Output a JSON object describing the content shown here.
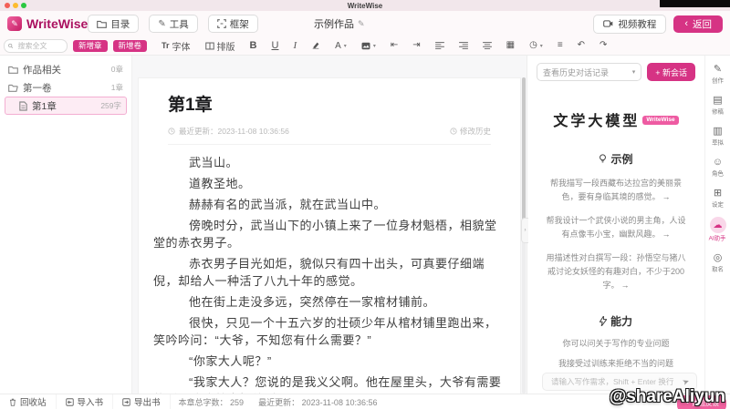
{
  "colors": {
    "accent": "#d63384",
    "brand_text": "#ab1160",
    "badge": "#ee5ba2"
  },
  "titlebar": {
    "window_title": "WriteWise"
  },
  "header": {
    "app_name": "WriteWise",
    "menu": [
      {
        "label": "目录"
      },
      {
        "label": "工具"
      },
      {
        "label": "框架"
      }
    ],
    "doc_title": "示例作品",
    "video_btn": "视频教程",
    "back_btn": "返回"
  },
  "toolbar": {
    "search_placeholder": "搜索全文",
    "add_chapter": "新增章",
    "add_volume": "新增卷",
    "font_icon": "Tr",
    "font_label": "字体",
    "layout_label": "排版",
    "bold": "B",
    "underline": "U",
    "italic": "I",
    "color_letter": "A"
  },
  "icons": {
    "pen": "✎",
    "edit": "✎",
    "back_chevron": "‹",
    "caret_down": "▾",
    "indent_left": "⇤",
    "indent_right": "⇥",
    "table": "▦",
    "clock": "◷",
    "list": "≡",
    "undo": "↶",
    "redo": "↷",
    "send": "➤",
    "collapse": "›",
    "arrow": "→",
    "feedback_dot": "◔"
  },
  "sidebar": {
    "items": [
      {
        "label": "作品相关",
        "count": "0章"
      },
      {
        "label": "第一卷",
        "count": "1章"
      },
      {
        "label": "第1章",
        "count": "259字"
      }
    ]
  },
  "editor": {
    "chapter_title": "第1章",
    "updated": "最近更新：2023-11-08 10:36:56",
    "history": "修改历史",
    "paragraphs": [
      "武当山。",
      "道教圣地。",
      "赫赫有名的武当派，就在武当山中。",
      "傍晚时分，武当山下的小镇上来了一位身材魁梧，相貌堂堂的赤衣男子。",
      "赤衣男子目光如炬，貌似只有四十出头，可真要仔细端倪，却给人一种活了八九十年的感觉。",
      "他在街上走没多远，突然停在一家棺材铺前。",
      "很快，只见一个十五六岁的壮硕少年从棺材铺里跑出来，笑吟吟问：“大爷，不知您有什么需要？”",
      "“你家大人呢？”",
      "“我家大人？您说的是我义父啊。他在屋里头，大爷有需要的话，我这就去把他叫来。”"
    ]
  },
  "assistant": {
    "history_select": "查看历史对话记录",
    "new_chat": "+ 新会话",
    "model_title": "文学大模型",
    "model_badge": "WriteWise",
    "examples_title": "示例",
    "examples": [
      "帮我描写一段西藏布达拉宫的美丽景色，要有身临其境的感觉。",
      "帮我设计一个武侠小说的男主角，人设有点像韦小宝，幽默风趣。",
      "用描述性对白撰写一段：孙悟空与猪八戒讨论女妖怪的有趣对白，不少于200字。"
    ],
    "abilities_title": "能力",
    "abilities": [
      "你可以问关于写作的专业问题",
      "我接受过训练来拒绝不当的问题"
    ],
    "input_placeholder": "请输入写作需求，Shift + Enter 换行"
  },
  "rail": {
    "items": [
      {
        "label": "创作",
        "icon": "✎"
      },
      {
        "label": "修稿",
        "icon": "▤"
      },
      {
        "label": "草拟",
        "icon": "▥"
      },
      {
        "label": "角色",
        "icon": "☺"
      },
      {
        "label": "设定",
        "icon": "⊞"
      },
      {
        "label": "AI助手",
        "icon": "☁"
      },
      {
        "label": "取名",
        "icon": "◎"
      }
    ]
  },
  "bottombar": {
    "trash": "回收站",
    "import": "导入书",
    "export": "导出书",
    "word_count": "本章总字数： 259",
    "updated": "最近更新： 2023-11-08 10:36:56"
  },
  "overlay": {
    "watermark": "@shareAliyun",
    "feedback": "体验反馈"
  }
}
